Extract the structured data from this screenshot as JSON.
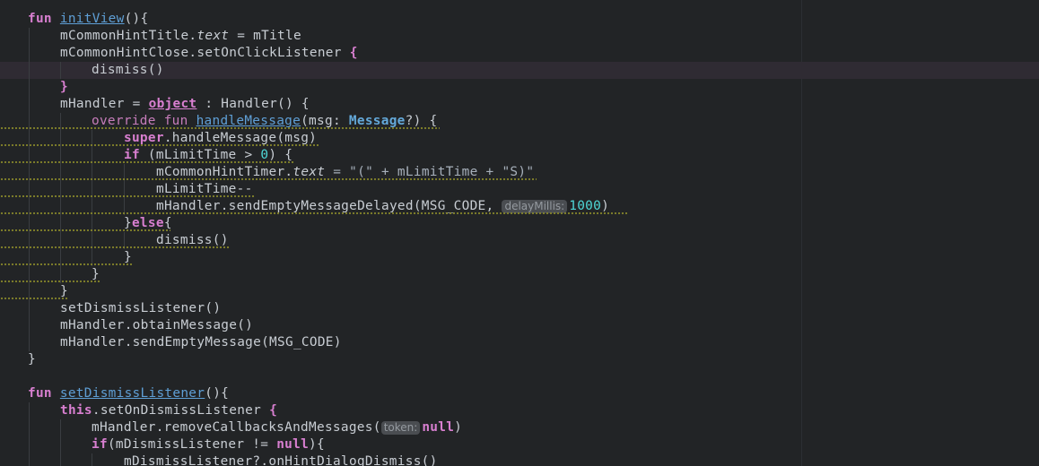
{
  "editor": {
    "language": "kotlin",
    "theme_colors": {
      "background": "#222426",
      "keyword": "#d87fd0",
      "function_declaration": "#5f9fd6",
      "number": "#4fd8d8",
      "text": "#c8cdd3",
      "current_line": "#2f2b33"
    },
    "tokens": {
      "fun": "fun",
      "initView": "initView",
      "initView_tail": "(){",
      "l2": "mCommonHintTitle.",
      "text": "text",
      "l2_tail": " = mTitle",
      "l3": "mCommonHintClose.setOnClickListener ",
      "brace_open": "{",
      "brace_close": "}",
      "l4": "dismiss()",
      "l6a": "mHandler = ",
      "object": "object",
      "l6b": " : Handler() {",
      "override": "override",
      "handleMessage": "handleMessage",
      "l7a": "(msg: ",
      "Message": "Message",
      "l7b": "?) {",
      "super": "super",
      "l8": ".handleMessage(msg)",
      "if": "if",
      "l9a": " (mLimitTime > ",
      "zero": "0",
      "l9b": ") {",
      "l10a": "mCommonHintTimer.",
      "l10b": " = \"(\" + mLimitTime + \"S)\"",
      "l11": "mLimitTime--",
      "l12a": "mHandler.sendEmptyMessageDelayed(MSG_CODE, ",
      "delayMillis_hint": "delayMillis:",
      "thousand": "1000",
      "paren_close": ")",
      "else": "else",
      "l13b": "{",
      "l14": "dismiss()",
      "l19": "setDismissListener()",
      "l20": "mHandler.obtainMessage()",
      "l21": "mHandler.sendEmptyMessage(MSG_CODE)",
      "setDismissListener": "setDismissListener",
      "this": "this",
      "l25": ".setOnDismissListener ",
      "l26a": "mHandler.removeCallbacksAndMessages(",
      "token_hint": "token:",
      "null": "null",
      "if2": "if",
      "l27a": "(mDismissListener != ",
      "l27b": "){",
      "l28": "mDismissListener?.onHintDialogDismiss()"
    }
  }
}
